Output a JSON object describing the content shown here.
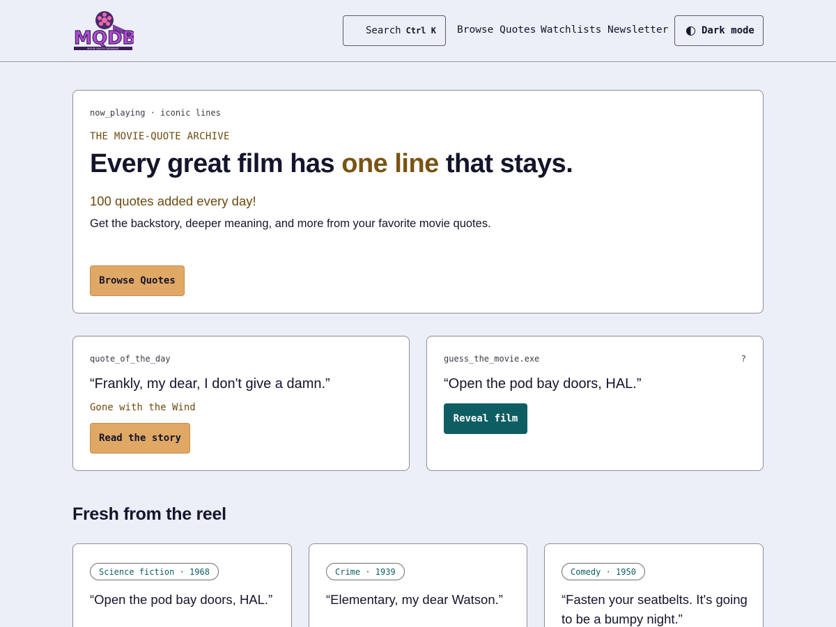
{
  "header": {
    "logo_text": "MQDB",
    "logo_subtitle": "MOVIE QUOTE DATABASE",
    "search_label": "Search",
    "search_shortcut": "Ctrl K",
    "nav": [
      "Browse Quotes",
      "Watchlists",
      "Newsletter"
    ],
    "dark_mode_label": "Dark mode"
  },
  "hero": {
    "kicker": "now_playing · iconic lines",
    "eyebrow": "THE MOVIE-QUOTE ARCHIVE",
    "headline_before": "Every great film has ",
    "headline_accent": "one line",
    "headline_after": " that stays.",
    "tagline": "100 quotes added every day!",
    "description": "Get the backstory, deeper meaning, and more from your favorite movie quotes.",
    "cta_label": "Browse Quotes"
  },
  "quote_of_the_day": {
    "kicker": "quote_of_the_day",
    "quote": "“Frankly, my dear, I don't give a damn.”",
    "film": "Gone with the Wind",
    "button_label": "Read the story"
  },
  "guess_the_movie": {
    "kicker": "guess_the_movie.exe",
    "help": "?",
    "quote": "“Open the pod bay doors, HAL.”",
    "button_label": "Reveal film"
  },
  "fresh": {
    "title": "Fresh from the reel",
    "cards": [
      {
        "tag": "Science fiction · 1968",
        "quote": "“Open the pod bay doors, HAL.”"
      },
      {
        "tag": "Crime · 1939",
        "quote": "“Elementary, my dear Watson.”"
      },
      {
        "tag": "Comedy · 1950",
        "quote": "“Fasten your seatbelts. It's going to be a bumpy night.”"
      }
    ]
  },
  "colors": {
    "background": "#eceff7",
    "accent_amber": "#e0a865",
    "accent_brown": "#7a5312",
    "accent_teal": "#0e5d63"
  }
}
